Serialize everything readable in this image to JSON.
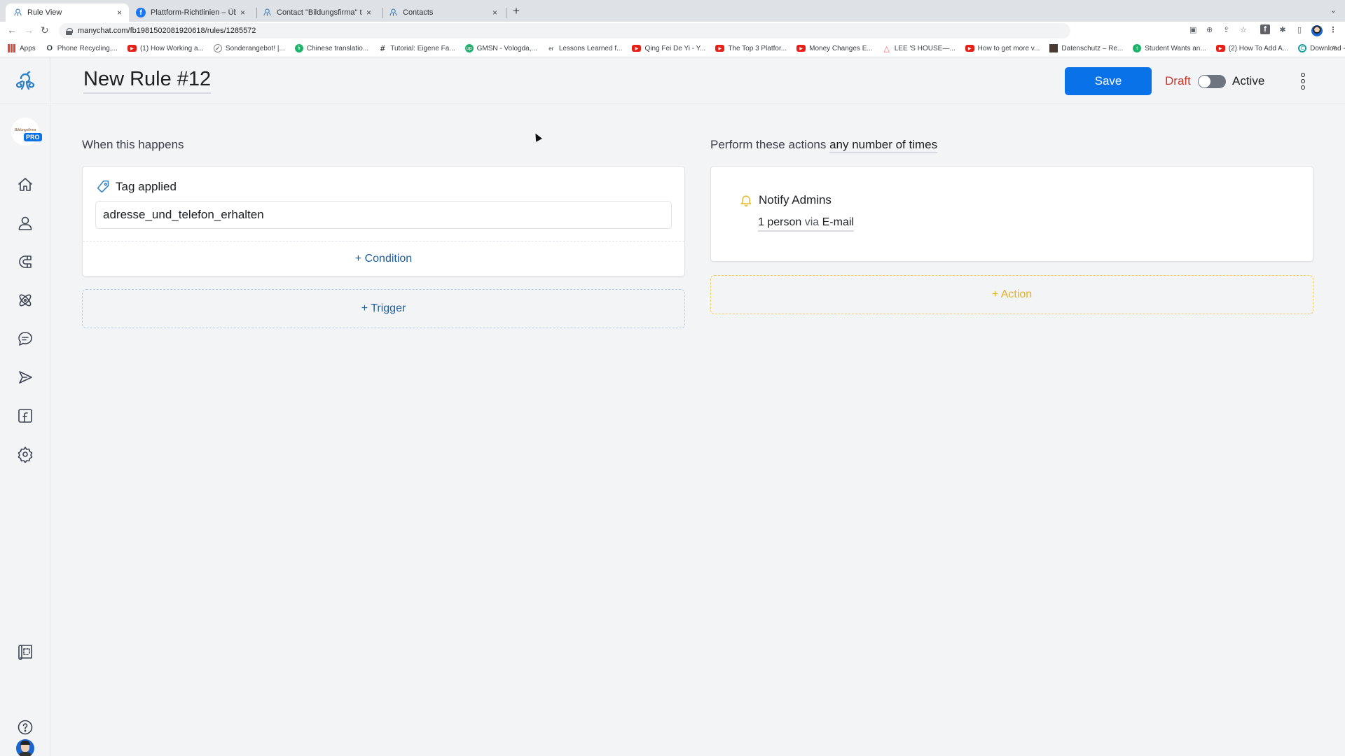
{
  "browser": {
    "tabs": [
      {
        "title": "Rule View",
        "icon": "manychat-icon",
        "active": true
      },
      {
        "title": "Plattform-Richtlinien – Übersicht",
        "icon": "facebook-icon",
        "active": false
      },
      {
        "title": "Contact \"Bildungsfirma\" through",
        "icon": "manychat-icon",
        "active": false
      },
      {
        "title": "Contacts",
        "icon": "manychat-icon",
        "active": false
      }
    ],
    "close_glyph": "×",
    "new_tab_glyph": "+",
    "tab_menu_glyph": "⌄",
    "nav": {
      "back": "←",
      "forward": "→",
      "reload": "↻"
    },
    "url": "manychat.com/fb198150208192061​8/rules/1285572",
    "bookmarks": [
      {
        "label": "Apps",
        "icon": "apps-grid-icon"
      },
      {
        "label": "Phone Recycling,...",
        "icon": "o2-icon"
      },
      {
        "label": "(1) How Working a...",
        "icon": "youtube-icon"
      },
      {
        "label": "Sonderangebot! |...",
        "icon": "v-logo-icon"
      },
      {
        "label": "Chinese translatio...",
        "icon": "green-circle-icon"
      },
      {
        "label": "Tutorial: Eigene Fa...",
        "icon": "hashtag-icon"
      },
      {
        "label": "GMSN - Vologda,...",
        "icon": "upwork-icon"
      },
      {
        "label": "Lessons Learned f...",
        "icon": "er-icon"
      },
      {
        "label": "Qing Fei De Yi - Y...",
        "icon": "youtube-icon"
      },
      {
        "label": "The Top 3 Platfor...",
        "icon": "youtube-icon"
      },
      {
        "label": "Money Changes E...",
        "icon": "youtube-icon"
      },
      {
        "label": "LEE 'S HOUSE—...",
        "icon": "airbnb-icon"
      },
      {
        "label": "How to get more v...",
        "icon": "youtube-icon"
      },
      {
        "label": "Datenschutz – Re...",
        "icon": "image-thumb-icon"
      },
      {
        "label": "Student Wants an...",
        "icon": "green-circle-icon"
      },
      {
        "label": "(2) How To Add A...",
        "icon": "youtube-icon"
      },
      {
        "label": "Download - Cooki...",
        "icon": "cookie-c-icon"
      }
    ],
    "bookmarks_more": "»"
  },
  "sidebar": {
    "account_badge": "PRO",
    "account_name": "Bildungsfirma",
    "items": [
      {
        "name": "home",
        "icon": "home-icon"
      },
      {
        "name": "contacts",
        "icon": "user-icon"
      },
      {
        "name": "growth-tools",
        "icon": "magnet-icon"
      },
      {
        "name": "automation",
        "icon": "atom-icon"
      },
      {
        "name": "live-chat",
        "icon": "chat-icon"
      },
      {
        "name": "broadcasting",
        "icon": "send-icon"
      },
      {
        "name": "facebook-ads",
        "icon": "facebook-square-icon"
      },
      {
        "name": "settings",
        "icon": "gear-icon"
      }
    ],
    "bottom_items": [
      {
        "name": "templates",
        "icon": "templates-icon"
      },
      {
        "name": "profile",
        "icon": "avatar"
      },
      {
        "name": "help",
        "icon": "help-icon"
      }
    ]
  },
  "header": {
    "title": "New Rule #12",
    "save_label": "Save",
    "draft_label": "Draft",
    "active_label": "Active",
    "status_active": false
  },
  "trigger_section": {
    "label": "When this happens",
    "trigger": {
      "title": "Tag applied",
      "tag_value": "adresse_und_telefon_erhalten"
    },
    "add_condition_label": "+ Condition",
    "add_trigger_label": "+ Trigger"
  },
  "action_section": {
    "label_prefix": "Perform these actions",
    "label_frequency": "any number of times",
    "action": {
      "title": "Notify Admins",
      "recipients": "1 person",
      "via_word": "via",
      "channel": "E-mail"
    },
    "add_action_label": "+ Action"
  },
  "colors": {
    "primary": "#0a72e8",
    "draft": "#c0392b",
    "trigger_accent": "#1f5e99",
    "action_accent": "#e0b12a"
  }
}
